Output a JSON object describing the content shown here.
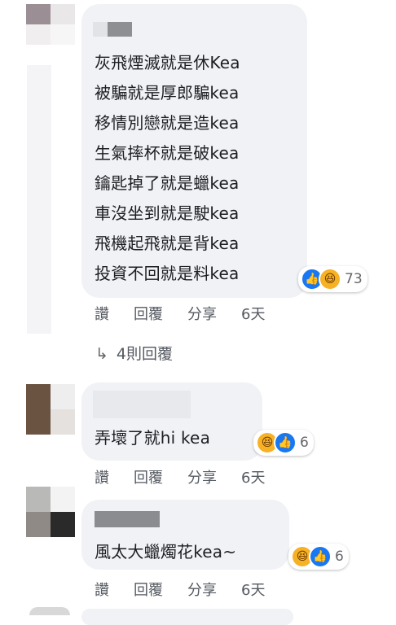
{
  "comments": [
    {
      "lines": [
        "灰飛煙滅就是休Kea",
        "被騙就是厚郎騙kea",
        "移情別戀就是造kea",
        "生氣摔杯就是破kea",
        "鑰匙掉了就是蠟kea",
        "車沒坐到就是駛kea",
        "飛機起飛就是背kea",
        "投資不回就是料kea"
      ],
      "reactions": {
        "icons": [
          "like-icon",
          "haha-icon"
        ],
        "count": "73"
      },
      "actions": {
        "like": "讚",
        "reply": "回覆",
        "share": "分享",
        "time": "6天"
      },
      "replies_label": "4則回覆"
    },
    {
      "lines": [
        "弄壞了就hi kea"
      ],
      "reactions": {
        "icons": [
          "haha-icon",
          "like-icon"
        ],
        "count": "6"
      },
      "actions": {
        "like": "讚",
        "reply": "回覆",
        "share": "分享",
        "time": "6天"
      }
    },
    {
      "lines": [
        "風太大蠟燭花kea~"
      ],
      "reactions": {
        "icons": [
          "haha-icon",
          "like-icon"
        ],
        "count": "6"
      },
      "actions": {
        "like": "讚",
        "reply": "回覆",
        "share": "分享",
        "time": "6天"
      }
    }
  ],
  "colors": {
    "bubble": "#f0f2f5",
    "like": "#1877f2",
    "haha": "#f7b125",
    "meta": "#65676b"
  }
}
